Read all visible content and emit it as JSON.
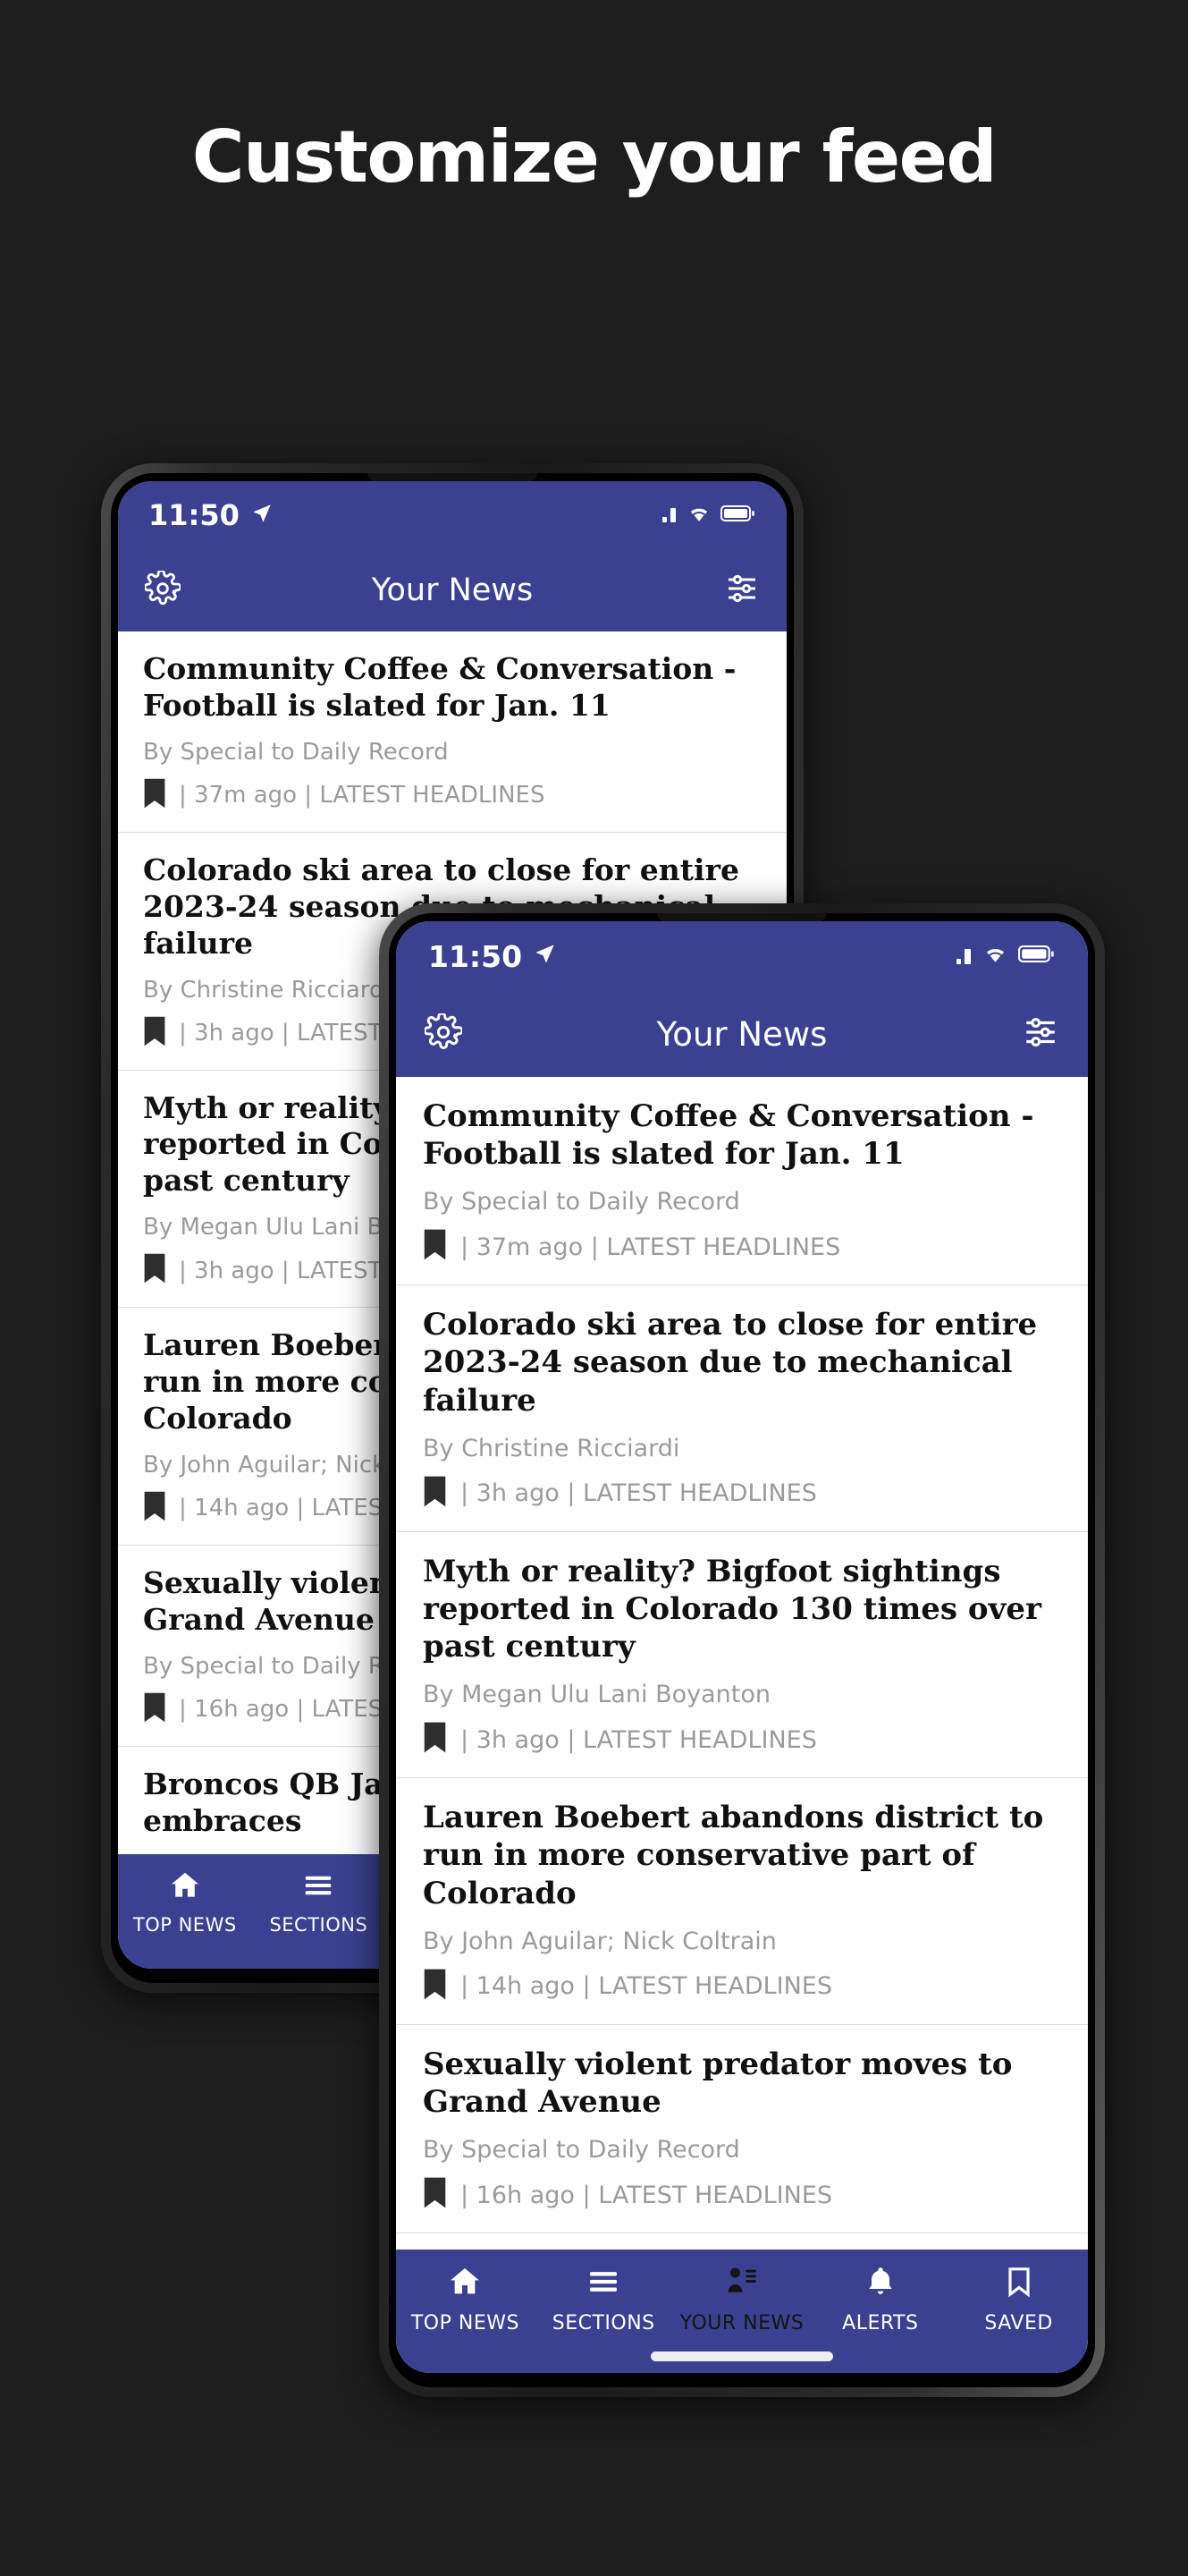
{
  "promo": {
    "title": "Customize your feed"
  },
  "theme": {
    "background": "#1e1e1e",
    "brand_blue": "#3b4190",
    "headline_color": "#111111",
    "byline_color": "#9b9b9b",
    "active_tab_color": "#141414"
  },
  "status_bar": {
    "time": "11:50",
    "location_icon": "navigation-arrow-icon",
    "signal_icon": "cellular-signal-icon",
    "wifi_icon": "wifi-icon",
    "battery_icon": "battery-full-icon"
  },
  "app_bar": {
    "settings_icon": "gear-icon",
    "title": "Your News",
    "filter_icon": "sliders-icon"
  },
  "feed": {
    "articles": [
      {
        "headline": "Community Coffee & Conversation - Football is slated for Jan. 11",
        "byline": "By Special to Daily Record",
        "bookmark_icon": "bookmark-icon",
        "meta": "| 37m ago | LATEST HEADLINES"
      },
      {
        "headline": "Colorado ski area to close for entire 2023-24 season due to mechanical failure",
        "byline": "By Christine Ricciardi",
        "bookmark_icon": "bookmark-icon",
        "meta": "| 3h ago | LATEST HEADLINES"
      },
      {
        "headline": "Myth or reality? Bigfoot sightings reported in Colorado 130 times over past century",
        "byline": "By Megan Ulu Lani Boyanton",
        "bookmark_icon": "bookmark-icon",
        "meta": "| 3h ago | LATEST HEADLINES"
      },
      {
        "headline": "Lauren Boebert abandons district to run in more conservative part of Colorado",
        "byline": "By John Aguilar; Nick Coltrain",
        "bookmark_icon": "bookmark-icon",
        "meta": "| 14h ago | LATEST HEADLINES"
      },
      {
        "headline": "Sexually violent predator moves to Grand Avenue",
        "byline": "By Special to Daily Record",
        "bookmark_icon": "bookmark-icon",
        "meta": "| 16h ago | LATEST HEADLINES"
      },
      {
        "headline": "Broncos QB Jarrett Stidham embraces",
        "byline": "",
        "bookmark_icon": "bookmark-icon",
        "meta": ""
      }
    ]
  },
  "bottom_nav": {
    "items": [
      {
        "label": "TOP NEWS",
        "icon": "home-icon",
        "active": false
      },
      {
        "label": "SECTIONS",
        "icon": "hamburger-menu-icon",
        "active": false
      },
      {
        "label": "YOUR NEWS",
        "icon": "person-list-icon",
        "active": true
      },
      {
        "label": "ALERTS",
        "icon": "bell-icon",
        "active": false
      },
      {
        "label": "SAVED",
        "icon": "bookmark-outline-icon",
        "active": false
      }
    ]
  }
}
